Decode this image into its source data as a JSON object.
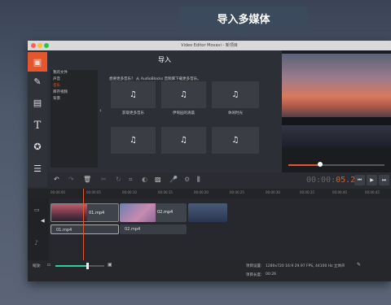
{
  "banner": {
    "text": "导入多媒体"
  },
  "window": {
    "title": "Video Editor Movavi - 新项目"
  },
  "sidebar": {
    "tools": [
      {
        "icon": "import-icon",
        "active": true
      },
      {
        "icon": "magic-wand-icon",
        "active": false
      },
      {
        "icon": "film-icon",
        "active": false
      },
      {
        "icon": "text-icon",
        "active": false
      },
      {
        "icon": "star-icon",
        "active": false
      },
      {
        "icon": "list-icon",
        "active": false
      }
    ]
  },
  "import_panel": {
    "title": "导入",
    "categories": [
      "我的文件",
      "声音",
      "音乐",
      "库存视频",
      "背景"
    ],
    "selected_category": "音乐",
    "description": "想要更多音乐？ 从 AudioBlocks 音频库下载更多音乐。",
    "tiles": [
      {
        "label": "获取更多音乐"
      },
      {
        "label": "伊甸园的清晨"
      },
      {
        "label": "休闲时光"
      }
    ]
  },
  "toolbar": {
    "timecode_prefix": "00:00:",
    "timecode_value": "05.200"
  },
  "timeline": {
    "ruler_labels": [
      "00:00:00",
      "00:00:05",
      "00:00:10",
      "00:00:15",
      "00:00:20",
      "00:00:25",
      "00:00:30",
      "00:00:35",
      "00:00:40",
      "00:00:45"
    ],
    "video_clips": [
      "01.mp4",
      "02.mp4"
    ],
    "audio_clips": [
      "01.mp4",
      "02.mp4"
    ]
  },
  "footer": {
    "zoom_label": "缩放:",
    "project_settings_label": "项目设置:",
    "project_settings_value": "1280x720 16:9 29.97 FPS, 44100 Hz 立体声",
    "project_length_label": "项目长度:",
    "project_length_value": "00:26"
  },
  "colors": {
    "accent": "#e4572e",
    "zoom": "#2ecf9c"
  }
}
